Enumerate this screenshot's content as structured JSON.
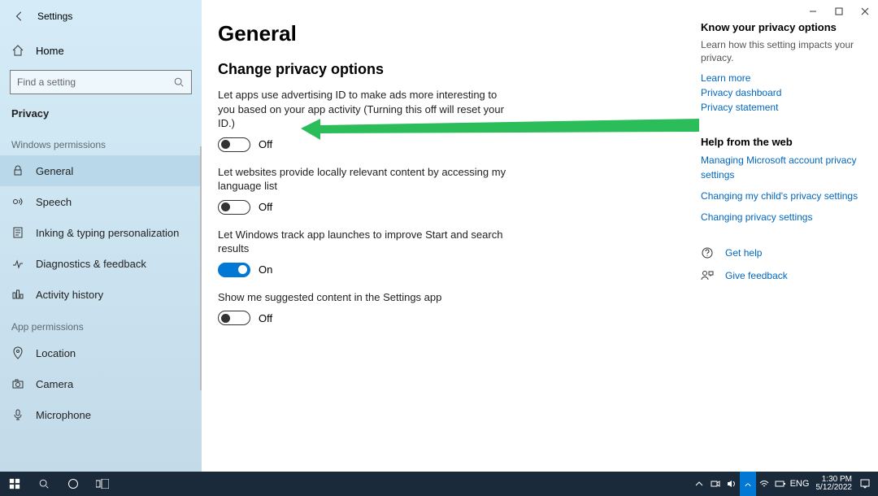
{
  "window": {
    "title": "Settings"
  },
  "sidebar": {
    "home": "Home",
    "search_placeholder": "Find a setting",
    "section": "Privacy",
    "group_windows": "Windows permissions",
    "group_app": "App permissions",
    "items": {
      "general": "General",
      "speech": "Speech",
      "inking": "Inking & typing personalization",
      "diagnostics": "Diagnostics & feedback",
      "activity": "Activity history",
      "location": "Location",
      "camera": "Camera",
      "microphone": "Microphone"
    }
  },
  "main": {
    "title": "General",
    "subtitle": "Change privacy options",
    "settings": {
      "ads": {
        "desc": "Let apps use advertising ID to make ads more interesting to you based on your app activity (Turning this off will reset your ID.)",
        "state": "Off",
        "on": false
      },
      "lang": {
        "desc": "Let websites provide locally relevant content by accessing my language list",
        "state": "Off",
        "on": false
      },
      "track": {
        "desc": "Let Windows track app launches to improve Start and search results",
        "state": "On",
        "on": true
      },
      "suggest": {
        "desc": "Show me suggested content in the Settings app",
        "state": "Off",
        "on": false
      }
    }
  },
  "right": {
    "know_head": "Know your privacy options",
    "know_text": "Learn how this setting impacts your privacy.",
    "learn_more": "Learn more",
    "dashboard": "Privacy dashboard",
    "statement": "Privacy statement",
    "help_head": "Help from the web",
    "help1": "Managing Microsoft account privacy settings",
    "help2": "Changing my child's privacy settings",
    "help3": "Changing privacy settings",
    "get_help": "Get help",
    "feedback": "Give feedback"
  },
  "taskbar": {
    "lang": "ENG",
    "time": "1:30 PM",
    "date": "5/12/2022"
  }
}
